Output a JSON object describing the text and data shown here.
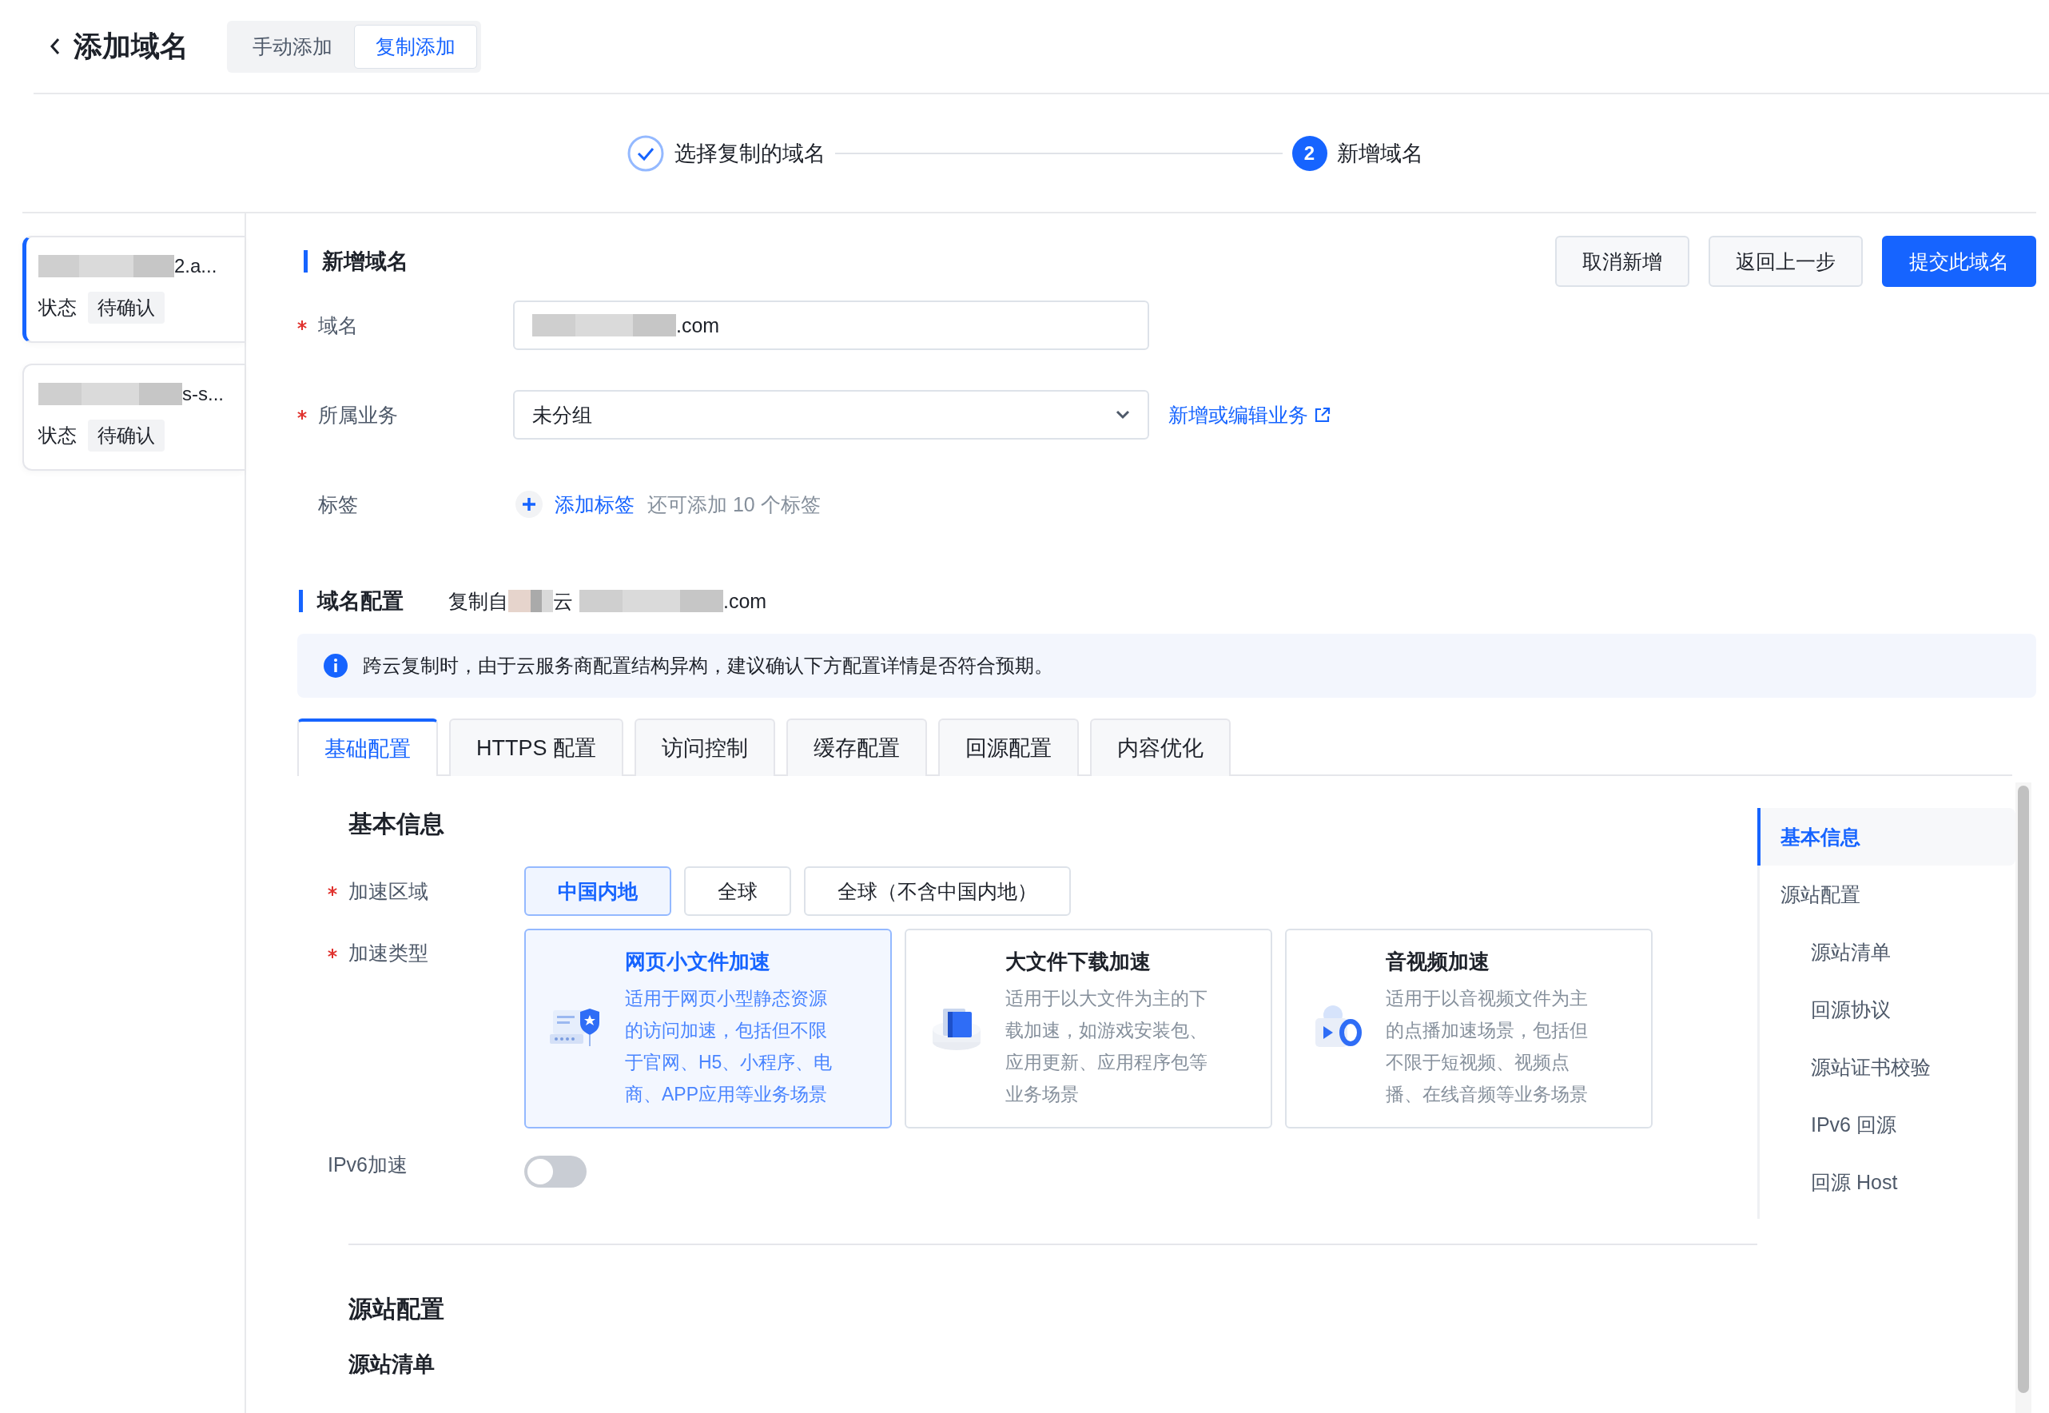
{
  "header": {
    "title": "添加域名",
    "modes": [
      {
        "label": "手动添加",
        "selected": false
      },
      {
        "label": "复制添加",
        "selected": true
      }
    ]
  },
  "steps": [
    {
      "label": "选择复制的域名",
      "done": true
    },
    {
      "label": "新增域名",
      "done": false,
      "number": "2"
    }
  ],
  "domain_list": [
    {
      "name_tail": "2.a...",
      "status_label": "状态",
      "status": "待确认",
      "selected": true
    },
    {
      "name_tail": "s-s...",
      "status_label": "状态",
      "status": "待确认",
      "selected": false
    }
  ],
  "form": {
    "title": "新增域名",
    "buttons": [
      {
        "label": "取消新增",
        "kind": "default"
      },
      {
        "label": "返回上一步",
        "kind": "default"
      },
      {
        "label": "提交此域名",
        "kind": "primary"
      }
    ],
    "domain": {
      "label": "域名",
      "required": true,
      "value_tail": ".com"
    },
    "business": {
      "label": "所属业务",
      "required": true,
      "value": "未分组",
      "link": "新增或编辑业务"
    },
    "tags": {
      "label": "标签",
      "required": false,
      "add": "添加标签",
      "hint": "还可添加 10 个标签"
    }
  },
  "config": {
    "title": "域名配置",
    "source_prefix": "复制自",
    "source_cloud": "云",
    "source_domain_tail": ".com",
    "notice": "跨云复制时，由于云服务商配置结构异构，建议确认下方配置详情是否符合预期。"
  },
  "tabs": [
    {
      "label": "基础配置",
      "selected": true
    },
    {
      "label": "HTTPS 配置",
      "selected": false
    },
    {
      "label": "访问控制",
      "selected": false
    },
    {
      "label": "缓存配置",
      "selected": false
    },
    {
      "label": "回源配置",
      "selected": false
    },
    {
      "label": "内容优化",
      "selected": false
    }
  ],
  "basic": {
    "title": "基本信息",
    "region": {
      "label": "加速区域",
      "required": true,
      "options": [
        {
          "label": "中国内地",
          "selected": true
        },
        {
          "label": "全球",
          "selected": false
        },
        {
          "label": "全球（不含中国内地）",
          "selected": false
        }
      ]
    },
    "type": {
      "label": "加速类型",
      "required": true,
      "options": [
        {
          "kind": "web",
          "title": "网页小文件加速",
          "desc": "适用于网页小型静态资源的访问加速，包括但不限于官网、H5、小程序、电商、APP应用等业务场景",
          "selected": true
        },
        {
          "kind": "download",
          "title": "大文件下载加速",
          "desc": "适用于以大文件为主的下载加速，如游戏安装包、应用更新、应用程序包等业务场景",
          "selected": false
        },
        {
          "kind": "media",
          "title": "音视频加速",
          "desc": "适用于以音视频文件为主的点播加速场景，包括但不限于短视频、视频点播、在线音频等业务场景",
          "selected": false
        }
      ]
    },
    "ipv6": {
      "label": "IPv6加速",
      "on": false
    }
  },
  "origin": {
    "title": "源站配置",
    "subtitle": "源站清单"
  },
  "anchor_nav": [
    {
      "label": "基本信息",
      "selected": true
    },
    {
      "label": "源站配置",
      "selected": false,
      "children": [
        {
          "label": "源站清单",
          "selected": false
        },
        {
          "label": "回源协议",
          "selected": false
        },
        {
          "label": "源站证书校验",
          "selected": false
        },
        {
          "label": "IPv6 回源",
          "selected": false
        },
        {
          "label": "回源 Host",
          "selected": false
        }
      ]
    }
  ]
}
